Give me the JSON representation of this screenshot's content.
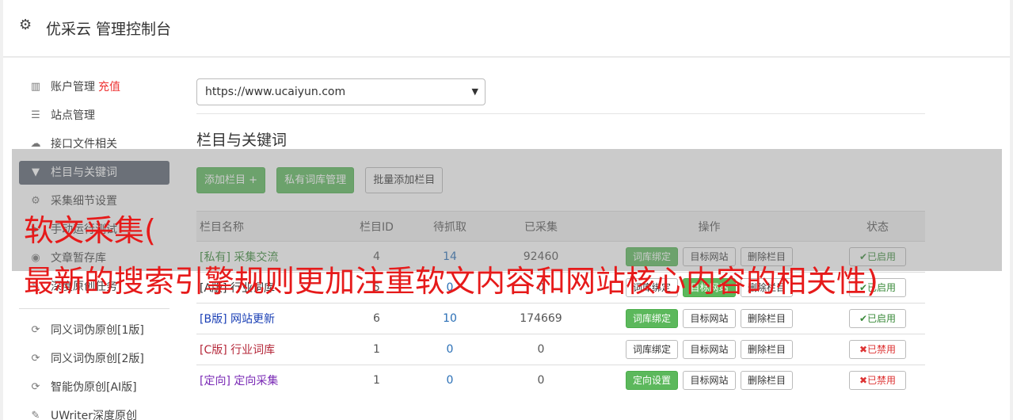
{
  "header": {
    "title": "优采云 管理控制台",
    "icon": "gear-icon"
  },
  "sidebar": {
    "items": [
      {
        "label": "账户管理",
        "extra": "充值",
        "icon": "bar-chart-icon"
      },
      {
        "label": "站点管理",
        "icon": "server-icon"
      },
      {
        "label": "接口文件相关",
        "icon": "cloud-upload-icon"
      },
      {
        "label": "栏目与关键词",
        "icon": "filter-icon",
        "active": true
      },
      {
        "label": "采集细节设置",
        "icon": "cogs-icon"
      },
      {
        "label": "手动运行测试",
        "icon": "play-icon"
      },
      {
        "label": "文章暂存库",
        "icon": "database-icon"
      },
      {
        "label": "深度原创任务",
        "icon": "edit-icon"
      }
    ],
    "items2": [
      {
        "label": "同义词伪原创[1版]",
        "icon": "refresh-icon"
      },
      {
        "label": "同义词伪原创[2版]",
        "icon": "refresh-icon"
      },
      {
        "label": "智能伪原创[AI版]",
        "icon": "refresh-icon"
      },
      {
        "label": "UWriter深度原创",
        "icon": "edit-icon"
      }
    ]
  },
  "site_select": {
    "value": "https://www.ucaiyun.com"
  },
  "section": {
    "title": "栏目与关键词"
  },
  "toolbar": {
    "add": "添加栏目 +",
    "private": "私有词库管理",
    "batch": "批量添加栏目"
  },
  "table": {
    "headers": [
      "栏目名称",
      "栏目ID",
      "待抓取",
      "已采集",
      "操作",
      "状态"
    ],
    "rows": [
      {
        "name": "[私有] 采集交流",
        "name_color": "#3a8a3a",
        "id": "4",
        "pending": "14",
        "collected": "92460",
        "op1": "词库绑定",
        "op1_green": true,
        "op2": "目标网站",
        "op3": "删除栏目",
        "status": "✔已启用",
        "on": true
      },
      {
        "name": "[A版] 行业词库",
        "name_color": "#333333",
        "id": "5",
        "pending": "0",
        "collected": "0",
        "op1": "词库绑定",
        "op1_green": false,
        "op2": "目标网站",
        "op2_green": true,
        "op3": "删除栏目",
        "status": "✔已启用",
        "on": true
      },
      {
        "name": "[B版] 网站更新",
        "name_color": "#1a3fb5",
        "id": "6",
        "pending": "10",
        "collected": "174669",
        "op1": "词库绑定",
        "op1_green": true,
        "op2": "目标网站",
        "op3": "删除栏目",
        "status": "✔已启用",
        "on": true
      },
      {
        "name": "[C版] 行业词库",
        "name_color": "#b5283a",
        "id": "1",
        "pending": "0",
        "collected": "0",
        "op1": "词库绑定",
        "op1_green": false,
        "op2": "目标网站",
        "op3": "删除栏目",
        "status": "✖已禁用",
        "on": false
      },
      {
        "name": "[定向] 定向采集",
        "name_color": "#7a2ab5",
        "id": "1",
        "pending": "0",
        "collected": "0",
        "op1": "定向设置",
        "op1_green": true,
        "op2": "目标网站",
        "op3": "删除栏目",
        "status": "✖已禁用",
        "on": false
      }
    ]
  },
  "overlay": {
    "line1": "软文采集(",
    "line2": "最新的搜索引擎规则更加注重软文内容和网站核心内容的相关性)"
  }
}
